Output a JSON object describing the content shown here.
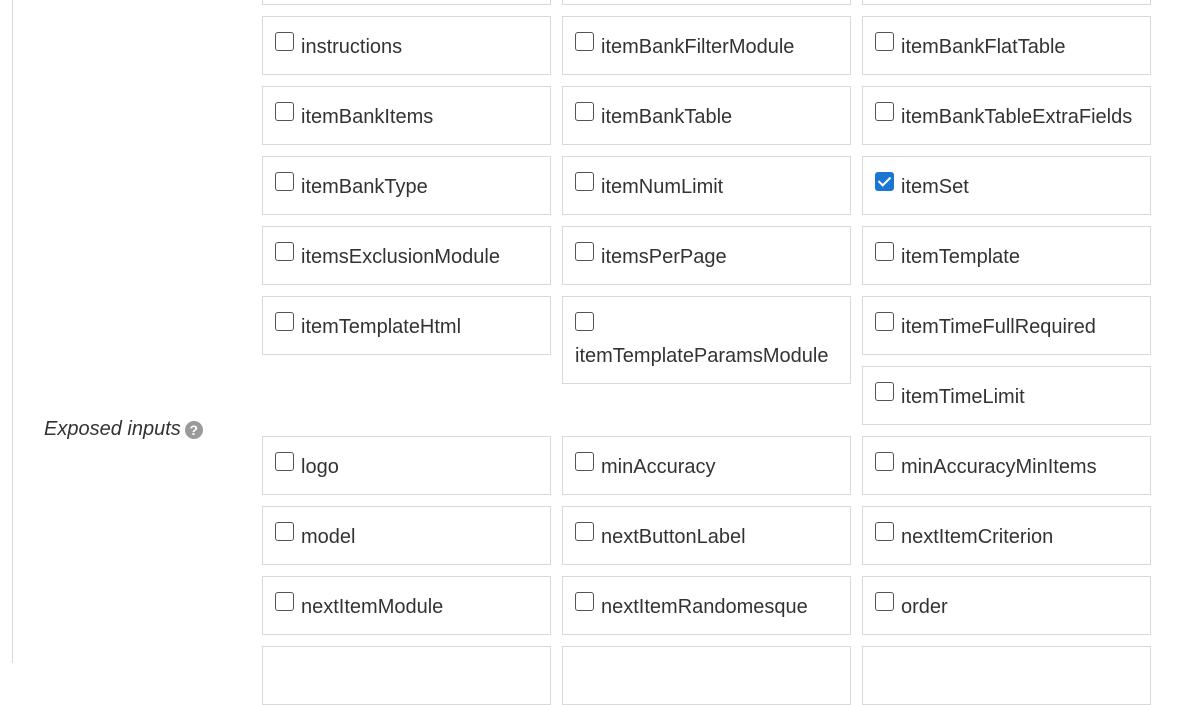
{
  "field": {
    "label": "Exposed inputs",
    "help_icon": "question-circle-icon"
  },
  "checkbox_color": "#1976d2",
  "rows": [
    [
      "",
      "",
      ""
    ],
    [
      {
        "label": "instructions",
        "checked": false
      },
      {
        "label": "itemBankFilterModule",
        "checked": false
      },
      {
        "label": "itemBankFlatTable",
        "checked": false
      }
    ],
    [
      {
        "label": "itemBankItems",
        "checked": false
      },
      {
        "label": "itemBankTable",
        "checked": false
      },
      {
        "label": "itemBankTableExtraFields",
        "checked": false
      }
    ],
    [
      {
        "label": "itemBankType",
        "checked": false
      },
      {
        "label": "itemNumLimit",
        "checked": false
      },
      {
        "label": "itemSet",
        "checked": true
      }
    ],
    [
      {
        "label": "itemsExclusionModule",
        "checked": false
      },
      {
        "label": "itemsPerPage",
        "checked": false
      },
      {
        "label": "itemTemplate",
        "checked": false
      }
    ],
    [
      {
        "label": "itemTemplateHtml",
        "checked": false
      },
      {
        "label": "itemTemplateParamsModule",
        "checked": false
      },
      {
        "label": "itemTimeFullRequired",
        "checked": false
      }
    ],
    [
      {
        "label": "itemTimeLimit",
        "checked": false
      }
    ],
    [
      {
        "label": "logo",
        "checked": false
      },
      {
        "label": "minAccuracy",
        "checked": false
      },
      {
        "label": "minAccuracyMinItems",
        "checked": false
      }
    ],
    [
      {
        "label": "model",
        "checked": false
      },
      {
        "label": "nextButtonLabel",
        "checked": false
      },
      {
        "label": "nextItemCriterion",
        "checked": false
      }
    ],
    [
      {
        "label": "nextItemModule",
        "checked": false
      },
      {
        "label": "nextItemRandomesque",
        "checked": false
      },
      {
        "label": "order",
        "checked": false
      }
    ]
  ]
}
